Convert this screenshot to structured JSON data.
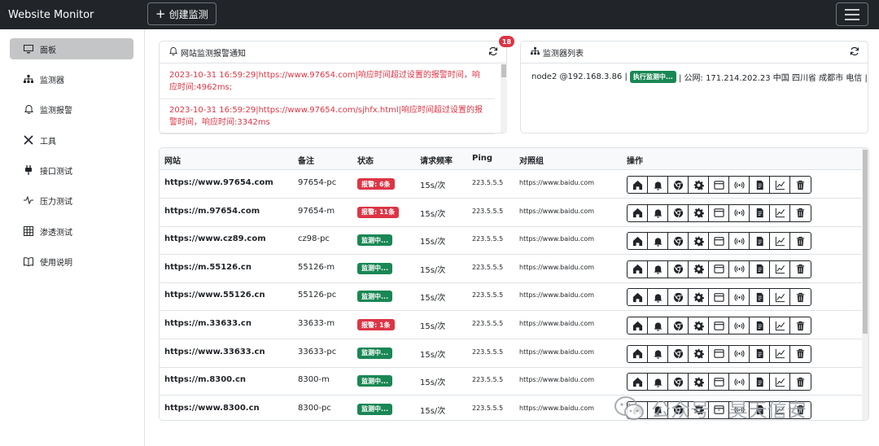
{
  "app": {
    "title": "Website Monitor",
    "create_label": "创建监测"
  },
  "sidebar": {
    "items": [
      {
        "label": "面板",
        "icon": "monitor-icon"
      },
      {
        "label": "监测器",
        "icon": "sitemap-icon"
      },
      {
        "label": "监测报警",
        "icon": "bell-icon"
      },
      {
        "label": "工具",
        "icon": "tools-icon"
      },
      {
        "label": "接口测试",
        "icon": "plug-icon"
      },
      {
        "label": "压力测试",
        "icon": "pulse-icon"
      },
      {
        "label": "渗透测试",
        "icon": "grid-icon"
      },
      {
        "label": "使用说明",
        "icon": "book-icon"
      }
    ]
  },
  "alerts_panel": {
    "title": "网站监测报警通知",
    "count": "18",
    "items": [
      "2023-10-31 16:59:29|https://www.97654.com|响应时间超过设置的报警时间，响应时间:4962ms;",
      "2023-10-31 16:59:29|https://www.97654.com/sjhfx.html|响应时间超过设置的报警时间，响应时间:3342ms"
    ]
  },
  "monitors_panel": {
    "title": "监测器列表",
    "node": "node2 @192.168.3.86 |",
    "status": "执行监测中...",
    "info": "| 公网: 171.214.202.23 中国 四川省 成都市 电信 |"
  },
  "table": {
    "headers": [
      "网站",
      "备注",
      "状态",
      "请求频率",
      "Ping",
      "对照组",
      "操作"
    ],
    "rows": [
      {
        "site": "https://www.97654.com",
        "note": "97654-pc",
        "status": "报警: 6条",
        "status_type": "alert",
        "freq": "15s/次",
        "ping": "223.5.5.5",
        "ref": "https://www.baidu.com"
      },
      {
        "site": "https://m.97654.com",
        "note": "97654-m",
        "status": "报警: 11条",
        "status_type": "alert",
        "freq": "15s/次",
        "ping": "223.5.5.5",
        "ref": "https://www.baidu.com"
      },
      {
        "site": "https://www.cz89.com",
        "note": "cz98-pc",
        "status": "监测中...",
        "status_type": "ok",
        "freq": "15s/次",
        "ping": "223.5.5.5",
        "ref": "https://www.baidu.com"
      },
      {
        "site": "https://m.55126.cn",
        "note": "55126-m",
        "status": "监测中...",
        "status_type": "ok",
        "freq": "15s/次",
        "ping": "223.5.5.5",
        "ref": "https://www.baidu.com"
      },
      {
        "site": "https://www.55126.cn",
        "note": "55126-pc",
        "status": "监测中...",
        "status_type": "ok",
        "freq": "15s/次",
        "ping": "223.5.5.5",
        "ref": "https://www.baidu.com"
      },
      {
        "site": "https://m.33633.cn",
        "note": "33633-m",
        "status": "报警: 1条",
        "status_type": "alert",
        "freq": "15s/次",
        "ping": "223.5.5.5",
        "ref": "https://www.baidu.com"
      },
      {
        "site": "https://www.33633.cn",
        "note": "33633-pc",
        "status": "监测中...",
        "status_type": "ok",
        "freq": "15s/次",
        "ping": "223.5.5.5",
        "ref": "https://www.baidu.com"
      },
      {
        "site": "https://m.8300.cn",
        "note": "8300-m",
        "status": "监测中...",
        "status_type": "ok",
        "freq": "15s/次",
        "ping": "223.5.5.5",
        "ref": "https://www.baidu.com"
      },
      {
        "site": "https://www.8300.cn",
        "note": "8300-pc",
        "status": "监测中...",
        "status_type": "ok",
        "freq": "15s/次",
        "ping": "223.5.5.5",
        "ref": "https://www.baidu.com"
      }
    ],
    "actions": [
      "home-icon",
      "bell-icon",
      "chrome-icon",
      "gear-icon",
      "window-icon",
      "broadcast-icon",
      "document-icon",
      "chart-icon",
      "trash-icon"
    ]
  },
  "watermark": "公众号 · 昊天信安",
  "colors": {
    "navbar": "#212529",
    "danger": "#dc3545",
    "success": "#198754"
  }
}
